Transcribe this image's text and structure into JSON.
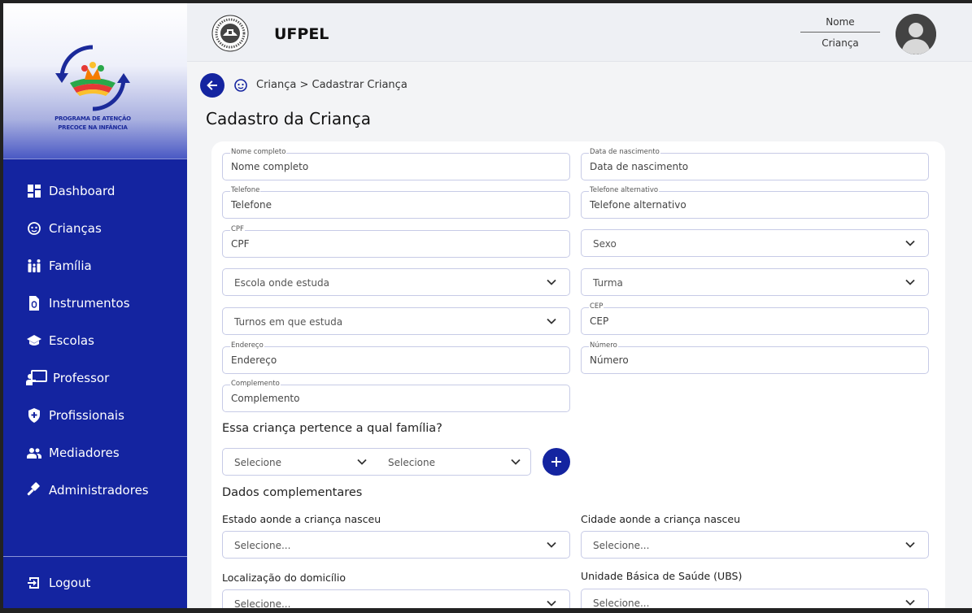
{
  "sidebar": {
    "logo_text_line1": "PROGRAMA DE ATENÇÃO",
    "logo_text_line2": "PRECOCE NA INFÂNCIA",
    "items": [
      {
        "label": "Dashboard",
        "icon": "dashboard-icon"
      },
      {
        "label": "Crianças",
        "icon": "child-face-icon"
      },
      {
        "label": "Família",
        "icon": "family-icon"
      },
      {
        "label": "Instrumentos",
        "icon": "document-icon"
      },
      {
        "label": "Escolas",
        "icon": "school-icon"
      },
      {
        "label": "Professor",
        "icon": "teacher-icon"
      },
      {
        "label": "Profissionais",
        "icon": "shield-icon"
      },
      {
        "label": "Mediadores",
        "icon": "people-icon"
      },
      {
        "label": "Administradores",
        "icon": "gavel-icon"
      }
    ],
    "logout_label": "Logout"
  },
  "header": {
    "brand": "UFPEL",
    "user_name": "Nome",
    "user_role": "Criança"
  },
  "breadcrumb": "Criança > Cadastrar Criança",
  "page_title": "Cadastro da Criança",
  "form": {
    "nome_float": "Nome completo",
    "nome_placeholder": "Nome completo",
    "nasc_float": "Data de nascimento",
    "nasc_placeholder": "Data de nascimento",
    "tel_float": "Telefone",
    "tel_placeholder": "Telefone",
    "telalt_float": "Telefone alternativo",
    "telalt_placeholder": "Telefone alternativo",
    "cpf_float": "CPF",
    "cpf_placeholder": "CPF",
    "sexo": "Sexo",
    "escola": "Escola onde estuda",
    "turma": "Turma",
    "turnos": "Turnos em que estuda",
    "cep_float": "CEP",
    "cep_placeholder": "CEP",
    "endereco_float": "Endereço",
    "endereco_placeholder": "Endereço",
    "numero_float": "Número",
    "numero_placeholder": "Número",
    "complemento_float": "Complemento",
    "complemento_placeholder": "Complemento",
    "familia_question": "Essa criança pertence a qual família?",
    "familia_select_1": "Selecione",
    "familia_select_2": "Selecione",
    "dados_complementares": "Dados complementares",
    "estado_label": "Estado aonde a criança nasceu",
    "estado_value": "Selecione...",
    "cidade_label": "Cidade aonde a criança nasceu",
    "cidade_value": "Selecione...",
    "localizacao_label": "Localização do domicílio",
    "localizacao_value": "Selecione...",
    "ubs_label": "Unidade Básica de Saúde (UBS)",
    "ubs_value": "Selecione..."
  },
  "colors": {
    "primary": "#1424a0",
    "field_border": "#c7cbe6"
  }
}
